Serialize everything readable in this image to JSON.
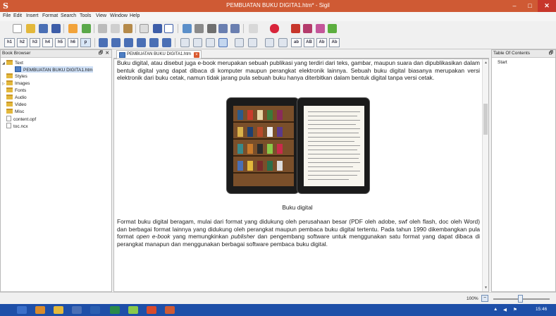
{
  "window": {
    "title": "PEMBUATAN BUKU DIGITA1.htm* - Sigil",
    "logo": "S",
    "minimize": "–",
    "maximize": "□",
    "close": "✕"
  },
  "menu": [
    "File",
    "Edit",
    "Insert",
    "Format",
    "Search",
    "Tools",
    "View",
    "Window",
    "Help"
  ],
  "heading_buttons": [
    "h1",
    "h2",
    "h3",
    "h4",
    "h5",
    "h6",
    "p"
  ],
  "style_buttons": [
    "ab",
    "AB",
    "Ab",
    "Ab"
  ],
  "book_browser": {
    "title": "Book Browser",
    "float_btn": "🗗",
    "close_btn": "✕",
    "items": [
      {
        "label": "Text",
        "type": "folder"
      },
      {
        "label": "PEMBUATAN BUKU DIGITA1.htm",
        "type": "html"
      },
      {
        "label": "Styles",
        "type": "folder"
      },
      {
        "label": "Images",
        "type": "folder"
      },
      {
        "label": "Fonts",
        "type": "folder"
      },
      {
        "label": "Audio",
        "type": "folder"
      },
      {
        "label": "Video",
        "type": "folder"
      },
      {
        "label": "Misc",
        "type": "folder"
      },
      {
        "label": "content.opf",
        "type": "file"
      },
      {
        "label": "toc.ncx",
        "type": "file"
      }
    ]
  },
  "tab": {
    "label": "PEMBUATAN BUKU DIGITA1.htm"
  },
  "editor": {
    "paragraph1": "Buku digital, atau disebut juga e-book merupakan sebuah publikasi yang terdiri dari teks, gambar, maupun suara dan dipublikasikan dalam bentuk digital yang dapat dibaca di komputer maupun perangkat elektronik lainnya. Sebuah buku digital biasanya merupakan versi elektronik dari buku cetak, namun tidak jarang pula sebuah buku hanya diterbitkan dalam bentuk digital tanpa versi cetak.",
    "caption": "Buku digital",
    "p2_part1": "Format buku digital beragam, mulai dari format yang didukung oleh perusahaan besar (PDF oleh adobe, swf oleh flash, doc oleh Word) dan berbagai format lainnya yang didukung oleh perangkat maupun pembaca buku digital tertentu. Pada tahun 1990 dikembangkan pula format ",
    "p2_em1": "open e-book",
    "p2_part2": " yang memungkinkan ",
    "p2_em2": "publisher",
    "p2_part3": " dan pengembang software untuk menggunakan satu format yang dapat dibaca di perangkat manapun dan menggunakan berbagai software pembaca buku digital."
  },
  "toc": {
    "title": "Table Of Contents",
    "float_btn": "🗗",
    "items": [
      "Start"
    ]
  },
  "status": {
    "zoom": "100%",
    "zoom_out": "−"
  },
  "taskbar": {
    "time": "15:46"
  },
  "colors": {
    "titlebar": "#cf5a34",
    "taskbar": "#1e4fa8",
    "folder": "#e3b83b"
  }
}
